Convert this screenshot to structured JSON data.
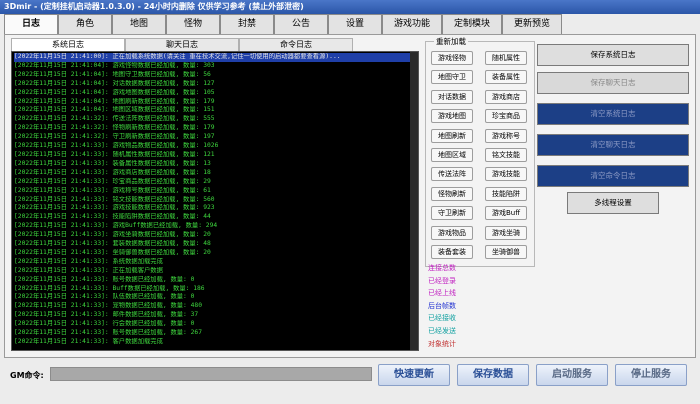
{
  "window": {
    "title": "3Dmir - (定制挂机启动器1.0.3.0) - 24小时内删除  仅供学习参考 (禁止外部泄密)"
  },
  "tabs": [
    "日志",
    "角色",
    "地图",
    "怪物",
    "封禁",
    "公告",
    "设置",
    "游戏功能",
    "定制模块",
    "更新预览"
  ],
  "log_tabs": [
    "系统日志",
    "聊天日志",
    "命令日志"
  ],
  "log_lines": [
    "[2022年11月15日 21:41:00]: 正在加载系统数据(请关注 重在技术交流,记住一切使用的启动器都要查看源)...",
    "[2022年11月15日 21:41:04]: 游戏怪物数据已经加载, 数量: 303",
    "[2022年11月15日 21:41:04]: 地图守卫数据已经加载, 数量: 56",
    "[2022年11月15日 21:41:04]: 对话数据数据已经加载, 数量: 127",
    "[2022年11月15日 21:41:04]: 游戏地图数据已经加载, 数量: 105",
    "[2022年11月15日 21:41:04]: 地图刷新数据已经加载, 数量: 179",
    "[2022年11月15日 21:41:04]: 地图区域数据已经加载, 数量: 151",
    "[2022年11月15日 21:41:32]: 传送法阵数据已经加载, 数量: 555",
    "[2022年11月15日 21:41:32]: 怪物刷新数据已经加载, 数量: 179",
    "[2022年11月15日 21:41:32]: 守卫刷新数据已经加载, 数量: 197",
    "[2022年11月15日 21:41:33]: 游戏物品数据已经加载, 数量: 1026",
    "[2022年11月15日 21:41:33]: 随机属性数据已经加载, 数量: 121",
    "[2022年11月15日 21:41:33]: 装备属性数据已经加载, 数量: 13",
    "[2022年11月15日 21:41:33]: 游戏商店数据已经加载, 数量: 18",
    "[2022年11月15日 21:41:33]: 珍宝商品数据已经加载, 数量: 29",
    "[2022年11月15日 21:41:33]: 游戏称号数据已经加载, 数量: 61",
    "[2022年11月15日 21:41:33]: 铭文技能数据已经加载, 数量: 560",
    "[2022年11月15日 21:41:33]: 游戏技能数据已经加载, 数量: 923",
    "[2022年11月15日 21:41:33]: 技能陷阱数据已经加载, 数量: 44",
    "[2022年11月15日 21:41:33]: 游戏Buff数据已经加载, 数量: 294",
    "[2022年11月15日 21:41:33]: 游戏坐骑数据已经加载, 数量: 20",
    "[2022年11月15日 21:41:33]: 套装数据数据已经加载, 数量: 48",
    "[2022年11月15日 21:41:33]: 坐骑御兽数据已经加载, 数量: 20",
    "[2022年11月15日 21:41:33]: 系统数据加载完成",
    "[2022年11月15日 21:41:33]: 正在加载客户数据",
    "[2022年11月15日 21:41:33]: 账号数据已经加载, 数量: 0",
    "[2022年11月15日 21:41:33]: Buff数据已经加载, 数量: 186",
    "[2022年11月15日 21:41:33]: 队伍数据已经加载, 数量: 0",
    "[2022年11月15日 21:41:33]: 宠物数据已经加载, 数量: 480",
    "[2022年11月15日 21:41:33]: 邮件数据已经加载, 数量: 37",
    "[2022年11月15日 21:41:33]: 行会数据已经加载, 数量: 0",
    "[2022年11月15日 21:41:33]: 账号数据已经加载, 数量: 267",
    "[2022年11月15日 21:41:33]: 客户数据加载完成"
  ],
  "reload_group": {
    "title": "重新加载",
    "buttons": [
      "游戏怪物",
      "随机属性",
      "地图守卫",
      "装备属性",
      "对话数据",
      "游戏商店",
      "游戏地图",
      "珍宝商品",
      "地图刷新",
      "游戏称号",
      "地图区域",
      "铭文技能",
      "传送法阵",
      "游戏技能",
      "怪物刷新",
      "技能陷阱",
      "守卫刷新",
      "游戏Buff",
      "游戏物品",
      "游戏坐骑",
      "装备套装",
      "坐骑御兽"
    ]
  },
  "stats": [
    {
      "label": "连接总数",
      "color": "#c020c0"
    },
    {
      "label": "已经登录",
      "color": "#c020c0"
    },
    {
      "label": "已经上线",
      "color": "#c020c0"
    },
    {
      "label": "后台帧数",
      "color": "#2030d0"
    },
    {
      "label": "已经接收",
      "color": "#10a0a0"
    },
    {
      "label": "已经发送",
      "color": "#10a0a0"
    },
    {
      "label": "对象统计",
      "color": "#c03030"
    }
  ],
  "side_buttons": [
    "保存系统日志",
    "保存聊天日志",
    "清空系统日志",
    "清空聊天日志",
    "清空命令日志",
    "多线程设置"
  ],
  "gm": {
    "label": "GM命令:",
    "value": ""
  },
  "bottom_buttons": [
    "快速更新",
    "保存数据",
    "启动服务",
    "停止服务"
  ]
}
